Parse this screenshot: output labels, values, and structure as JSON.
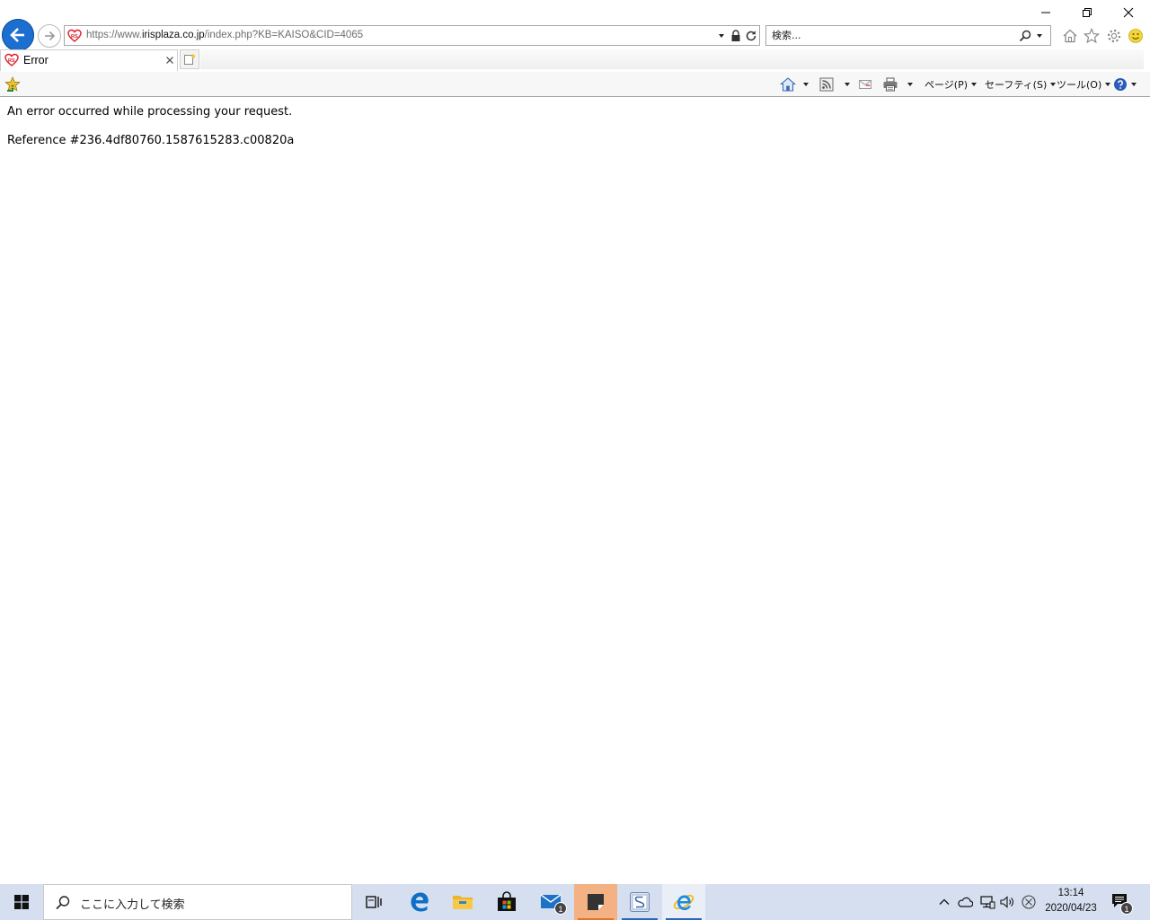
{
  "window": {
    "minimize_icon": "minimize-icon",
    "restore_icon": "restore-icon",
    "close_icon": "close-icon"
  },
  "nav": {
    "back_icon": "back-arrow-icon",
    "forward_icon": "forward-arrow-icon"
  },
  "address_bar": {
    "scheme": "https://www.",
    "domain": "irisplaza.co.jp",
    "path": "/index.php?KB=KAISO&CID=4065",
    "favicon": "irisplaza-favicon"
  },
  "search": {
    "placeholder": "検索..."
  },
  "tab": {
    "title": "Error"
  },
  "command_bar": {
    "page_label": "ページ(P)",
    "safety_label": "セーフティ(S)",
    "tools_label": "ツール(O)"
  },
  "content": {
    "error_message": "An error occurred while processing your request.",
    "reference": "Reference #236.4df80760.1587615283.c00820a"
  },
  "taskbar": {
    "search_placeholder": "ここに入力して検索",
    "mail_badge": "1",
    "clock_time": "13:14",
    "clock_date": "2020/04/23",
    "notification_badge": "1"
  },
  "colors": {
    "ie_blue": "#1c6fd1",
    "taskbar_bg": "#d6dff0",
    "sticky_notes_bg": "#f4b183"
  }
}
